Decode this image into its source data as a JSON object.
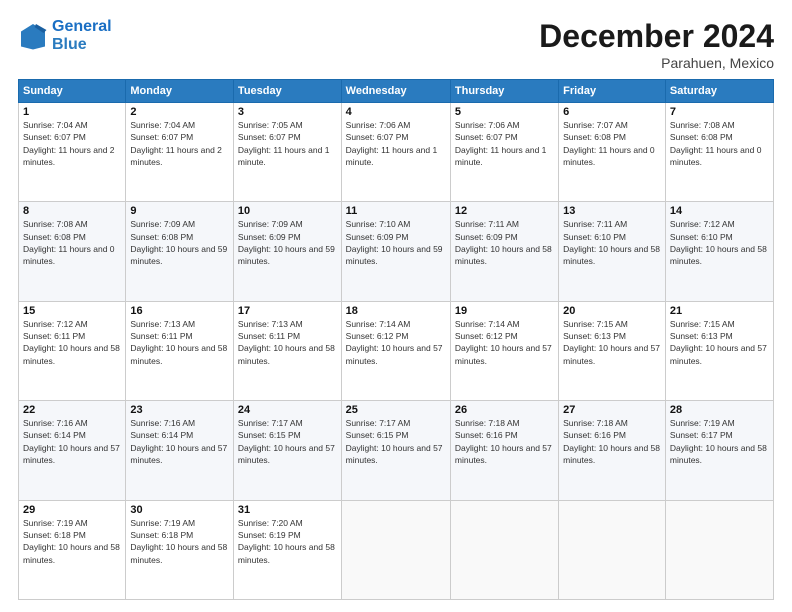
{
  "logo": {
    "line1": "General",
    "line2": "Blue"
  },
  "title": "December 2024",
  "subtitle": "Parahuen, Mexico",
  "weekdays": [
    "Sunday",
    "Monday",
    "Tuesday",
    "Wednesday",
    "Thursday",
    "Friday",
    "Saturday"
  ],
  "weeks": [
    [
      {
        "day": "1",
        "sunrise": "7:04 AM",
        "sunset": "6:07 PM",
        "daylight": "11 hours and 2 minutes."
      },
      {
        "day": "2",
        "sunrise": "7:04 AM",
        "sunset": "6:07 PM",
        "daylight": "11 hours and 2 minutes."
      },
      {
        "day": "3",
        "sunrise": "7:05 AM",
        "sunset": "6:07 PM",
        "daylight": "11 hours and 1 minute."
      },
      {
        "day": "4",
        "sunrise": "7:06 AM",
        "sunset": "6:07 PM",
        "daylight": "11 hours and 1 minute."
      },
      {
        "day": "5",
        "sunrise": "7:06 AM",
        "sunset": "6:07 PM",
        "daylight": "11 hours and 1 minute."
      },
      {
        "day": "6",
        "sunrise": "7:07 AM",
        "sunset": "6:08 PM",
        "daylight": "11 hours and 0 minutes."
      },
      {
        "day": "7",
        "sunrise": "7:08 AM",
        "sunset": "6:08 PM",
        "daylight": "11 hours and 0 minutes."
      }
    ],
    [
      {
        "day": "8",
        "sunrise": "7:08 AM",
        "sunset": "6:08 PM",
        "daylight": "11 hours and 0 minutes."
      },
      {
        "day": "9",
        "sunrise": "7:09 AM",
        "sunset": "6:08 PM",
        "daylight": "10 hours and 59 minutes."
      },
      {
        "day": "10",
        "sunrise": "7:09 AM",
        "sunset": "6:09 PM",
        "daylight": "10 hours and 59 minutes."
      },
      {
        "day": "11",
        "sunrise": "7:10 AM",
        "sunset": "6:09 PM",
        "daylight": "10 hours and 59 minutes."
      },
      {
        "day": "12",
        "sunrise": "7:11 AM",
        "sunset": "6:09 PM",
        "daylight": "10 hours and 58 minutes."
      },
      {
        "day": "13",
        "sunrise": "7:11 AM",
        "sunset": "6:10 PM",
        "daylight": "10 hours and 58 minutes."
      },
      {
        "day": "14",
        "sunrise": "7:12 AM",
        "sunset": "6:10 PM",
        "daylight": "10 hours and 58 minutes."
      }
    ],
    [
      {
        "day": "15",
        "sunrise": "7:12 AM",
        "sunset": "6:11 PM",
        "daylight": "10 hours and 58 minutes."
      },
      {
        "day": "16",
        "sunrise": "7:13 AM",
        "sunset": "6:11 PM",
        "daylight": "10 hours and 58 minutes."
      },
      {
        "day": "17",
        "sunrise": "7:13 AM",
        "sunset": "6:11 PM",
        "daylight": "10 hours and 58 minutes."
      },
      {
        "day": "18",
        "sunrise": "7:14 AM",
        "sunset": "6:12 PM",
        "daylight": "10 hours and 57 minutes."
      },
      {
        "day": "19",
        "sunrise": "7:14 AM",
        "sunset": "6:12 PM",
        "daylight": "10 hours and 57 minutes."
      },
      {
        "day": "20",
        "sunrise": "7:15 AM",
        "sunset": "6:13 PM",
        "daylight": "10 hours and 57 minutes."
      },
      {
        "day": "21",
        "sunrise": "7:15 AM",
        "sunset": "6:13 PM",
        "daylight": "10 hours and 57 minutes."
      }
    ],
    [
      {
        "day": "22",
        "sunrise": "7:16 AM",
        "sunset": "6:14 PM",
        "daylight": "10 hours and 57 minutes."
      },
      {
        "day": "23",
        "sunrise": "7:16 AM",
        "sunset": "6:14 PM",
        "daylight": "10 hours and 57 minutes."
      },
      {
        "day": "24",
        "sunrise": "7:17 AM",
        "sunset": "6:15 PM",
        "daylight": "10 hours and 57 minutes."
      },
      {
        "day": "25",
        "sunrise": "7:17 AM",
        "sunset": "6:15 PM",
        "daylight": "10 hours and 57 minutes."
      },
      {
        "day": "26",
        "sunrise": "7:18 AM",
        "sunset": "6:16 PM",
        "daylight": "10 hours and 57 minutes."
      },
      {
        "day": "27",
        "sunrise": "7:18 AM",
        "sunset": "6:16 PM",
        "daylight": "10 hours and 58 minutes."
      },
      {
        "day": "28",
        "sunrise": "7:19 AM",
        "sunset": "6:17 PM",
        "daylight": "10 hours and 58 minutes."
      }
    ],
    [
      {
        "day": "29",
        "sunrise": "7:19 AM",
        "sunset": "6:18 PM",
        "daylight": "10 hours and 58 minutes."
      },
      {
        "day": "30",
        "sunrise": "7:19 AM",
        "sunset": "6:18 PM",
        "daylight": "10 hours and 58 minutes."
      },
      {
        "day": "31",
        "sunrise": "7:20 AM",
        "sunset": "6:19 PM",
        "daylight": "10 hours and 58 minutes."
      },
      null,
      null,
      null,
      null
    ]
  ]
}
